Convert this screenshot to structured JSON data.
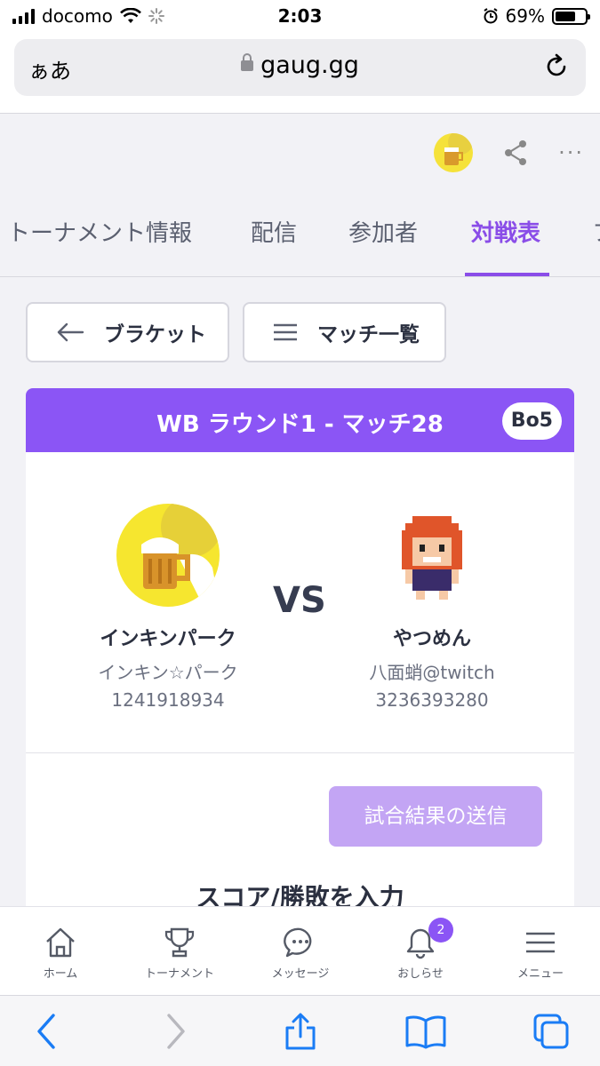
{
  "status_bar": {
    "carrier": "docomo",
    "time": "2:03",
    "battery_percent": "69%",
    "battery_level": 0.69
  },
  "address_bar": {
    "aa_label": "ぁあ",
    "domain": "gaug.gg"
  },
  "tabs": [
    {
      "label": "トーナメント情報",
      "active": false
    },
    {
      "label": "配信",
      "active": false
    },
    {
      "label": "参加者",
      "active": false
    },
    {
      "label": "対戦表",
      "active": true
    },
    {
      "label": "フ",
      "active": false
    }
  ],
  "buttons": {
    "bracket_label": "ブラケット",
    "match_list_label": "マッチ一覧"
  },
  "match": {
    "title": "WB ラウンド1 - マッチ28",
    "format_badge": "Bo5",
    "vs_label": "VS",
    "player1": {
      "name": "インキンパーク",
      "handle": "インキン☆パーク",
      "id": "1241918934"
    },
    "player2": {
      "name": "やつめん",
      "handle": "八面蛸@twitch",
      "id": "3236393280"
    },
    "submit_label": "試合結果の送信",
    "score_heading": "スコア/勝敗を入力"
  },
  "app_nav": [
    {
      "label": "ホーム",
      "icon": "home-icon"
    },
    {
      "label": "トーナメント",
      "icon": "trophy-icon"
    },
    {
      "label": "メッセージ",
      "icon": "chat-icon"
    },
    {
      "label": "おしらせ",
      "icon": "bell-icon",
      "badge": "2"
    },
    {
      "label": "メニュー",
      "icon": "menu-icon"
    }
  ],
  "colors": {
    "accent": "#8b55f5",
    "submit_disabled": "#c3a5f4"
  }
}
